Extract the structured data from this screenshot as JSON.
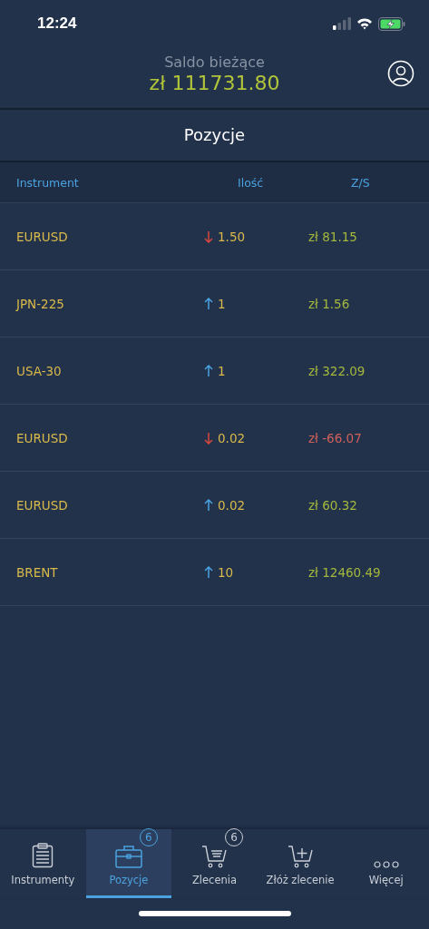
{
  "status_bar": {
    "time": "12:24"
  },
  "header": {
    "title": "Saldo bieżące",
    "balance": "zł 111731.80"
  },
  "section_title": "Pozycje",
  "table": {
    "columns": [
      "Instrument",
      "Ilość",
      "Z/S"
    ],
    "rows": [
      {
        "instrument": "EURUSD",
        "short": true,
        "quantity": "1.50",
        "pnl": "zł 81.15",
        "loss": false
      },
      {
        "instrument": "JPN-225",
        "short": false,
        "quantity": "1",
        "pnl": "zł 1.56",
        "loss": false
      },
      {
        "instrument": "USA-30",
        "short": false,
        "quantity": "1",
        "pnl": "zł 322.09",
        "loss": false
      },
      {
        "instrument": "EURUSD",
        "short": true,
        "quantity": "0.02",
        "pnl": "zł -66.07",
        "loss": true
      },
      {
        "instrument": "EURUSD",
        "short": false,
        "quantity": "0.02",
        "pnl": "zł 60.32",
        "loss": false
      },
      {
        "instrument": "BRENT",
        "short": false,
        "quantity": "10",
        "pnl": "zł 12460.49",
        "loss": false
      }
    ]
  },
  "tab_bar": [
    {
      "kind": "clipboard",
      "label": "Instrumenty",
      "selected": false
    },
    {
      "kind": "briefcase",
      "label": "Pozycje",
      "selected": true,
      "badge": "6"
    },
    {
      "kind": "cart",
      "label": "Zlecenia",
      "selected": false,
      "badge": "6"
    },
    {
      "kind": "cart-plus",
      "label": "Złóż zlecenie",
      "selected": false
    },
    {
      "kind": "more",
      "label": "Więcej",
      "selected": false
    }
  ]
}
